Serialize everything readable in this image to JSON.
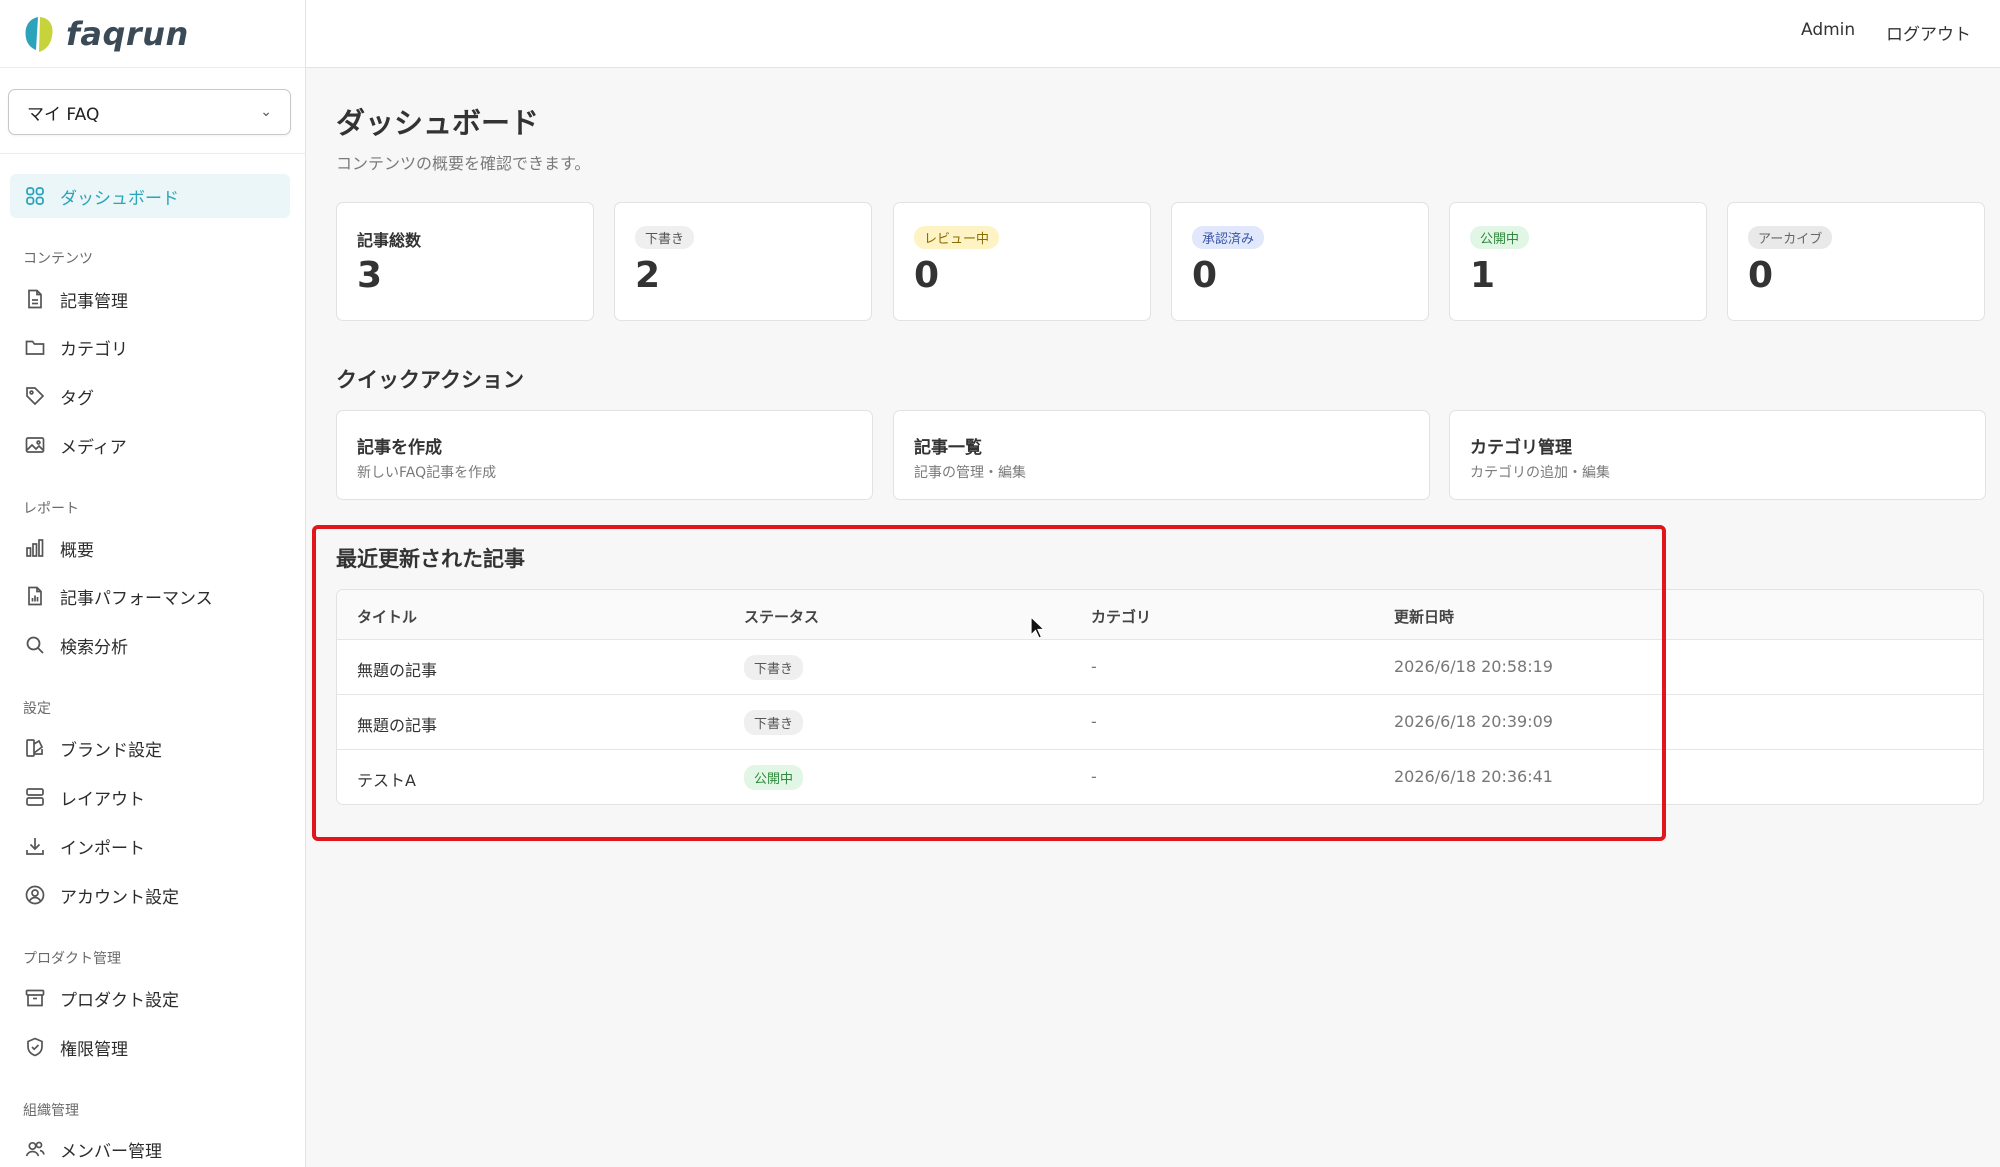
{
  "brand": {
    "name": "faqrun"
  },
  "sidebar": {
    "space_select": "マイ FAQ",
    "items": [
      {
        "label": "ダッシュボード",
        "icon": "grid-icon",
        "active": true
      },
      {
        "label": "記事管理",
        "icon": "file-icon"
      },
      {
        "label": "カテゴリ",
        "icon": "folder-icon"
      },
      {
        "label": "タグ",
        "icon": "tag-icon"
      },
      {
        "label": "メディア",
        "icon": "image-icon"
      },
      {
        "label": "概要",
        "icon": "bar-chart-icon"
      },
      {
        "label": "記事パフォーマンス",
        "icon": "file-chart-icon"
      },
      {
        "label": "検索分析",
        "icon": "search-icon"
      },
      {
        "label": "ブランド設定",
        "icon": "palette-icon"
      },
      {
        "label": "レイアウト",
        "icon": "layout-icon"
      },
      {
        "label": "インポート",
        "icon": "download-icon"
      },
      {
        "label": "アカウント設定",
        "icon": "user-circle-icon"
      },
      {
        "label": "プロダクト設定",
        "icon": "archive-icon"
      },
      {
        "label": "権限管理",
        "icon": "shield-icon"
      },
      {
        "label": "メンバー管理",
        "icon": "users-icon"
      }
    ],
    "sections": {
      "content": "コンテンツ",
      "report": "レポート",
      "settings": "設定",
      "product": "プロダクト管理",
      "org": "組織管理"
    }
  },
  "header": {
    "user": "Admin",
    "logout": "ログアウト"
  },
  "main": {
    "title": "ダッシュボード",
    "subtitle": "コンテンツの概要を確認できます。",
    "stats": [
      {
        "label": "記事総数",
        "value": "3"
      },
      {
        "label": "下書き",
        "value": "2",
        "pill_bg": "#efefef",
        "pill_fg": "#555555"
      },
      {
        "label": "レビュー中",
        "value": "0",
        "pill_bg": "#fdf3c4",
        "pill_fg": "#8a6d00"
      },
      {
        "label": "承認済み",
        "value": "0",
        "pill_bg": "#e1e8fb",
        "pill_fg": "#3b56a6"
      },
      {
        "label": "公開中",
        "value": "1",
        "pill_bg": "#e2f6e5",
        "pill_fg": "#2d8a3c"
      },
      {
        "label": "アーカイブ",
        "value": "0",
        "pill_bg": "#e9e9e9",
        "pill_fg": "#666666"
      }
    ],
    "quick_actions_title": "クイックアクション",
    "quick_actions": [
      {
        "title": "記事を作成",
        "desc": "新しいFAQ記事を作成"
      },
      {
        "title": "記事一覧",
        "desc": "記事の管理・編集"
      },
      {
        "title": "カテゴリ管理",
        "desc": "カテゴリの追加・編集"
      }
    ],
    "recent_title": "最近更新された記事",
    "table": {
      "headers": [
        "タイトル",
        "ステータス",
        "カテゴリ",
        "更新日時"
      ],
      "rows": [
        {
          "title": "無題の記事",
          "status": "下書き",
          "status_type": "draft",
          "category": "-",
          "updated": "2026/6/18 20:58:19"
        },
        {
          "title": "無題の記事",
          "status": "下書き",
          "status_type": "draft",
          "category": "-",
          "updated": "2026/6/18 20:39:09"
        },
        {
          "title": "テストA",
          "status": "公開中",
          "status_type": "published",
          "category": "-",
          "updated": "2026/6/18 20:36:41"
        }
      ]
    }
  },
  "colors": {
    "accent": "#2ba3bb",
    "highlight": "#e0161b",
    "draft_bg": "#efefef",
    "published_bg": "#e2f6e5"
  }
}
